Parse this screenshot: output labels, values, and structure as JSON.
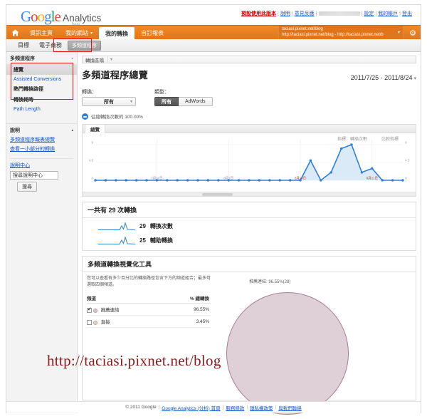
{
  "brand": {
    "google": "Google",
    "letters": [
      "G",
      "o",
      "o",
      "g",
      "l",
      "e"
    ],
    "product": "Analytics",
    "beta": "beta"
  },
  "toplinks": {
    "default_version": "預設使用此版本",
    "help": "說明",
    "feedback": "意見反應",
    "settings": "設定",
    "my_account": "我的帳戶",
    "signout": "登出"
  },
  "nav": {
    "home_icon": "home-icon",
    "tabs": [
      {
        "label": "資訊主頁",
        "active": false,
        "caret": false
      },
      {
        "label": "我的網站",
        "active": false,
        "caret": true
      },
      {
        "label": "我的轉換",
        "active": true,
        "caret": false
      },
      {
        "label": "自訂報表",
        "active": false,
        "caret": false
      }
    ],
    "account": {
      "name": "taciasi.pixnet.net/blog",
      "profile": "http://taciasi.pixnet.net/blog - http://taciasi.pixnet.net/b"
    }
  },
  "subnav": {
    "items": [
      {
        "label": "目標",
        "selected": false
      },
      {
        "label": "電子商務",
        "selected": false
      },
      {
        "label": "多頻道程序",
        "selected": true
      }
    ]
  },
  "sidebar": {
    "section_title": "多頻道程序",
    "items": [
      {
        "label": "總覽",
        "active": true
      },
      {
        "label": "Assisted Conversions",
        "active": false
      },
      {
        "label": "熱門轉換路徑",
        "active": false
      },
      {
        "label": "轉換耗時",
        "active": false
      },
      {
        "label": "Path Length",
        "active": false
      }
    ],
    "help": {
      "title": "說明",
      "links": [
        "多頻道程序報表總覽",
        "查看一小部分的轉換"
      ],
      "help_center": "說明中心",
      "search_value": "搜尋說明中心",
      "search_button": "搜尋"
    }
  },
  "main": {
    "segment_bar": "轉換區隔",
    "page_title": "多頻道程序總覽",
    "date_range": "2011/7/25 - 2011/8/24",
    "filters": {
      "conversion_label": "轉換：",
      "conversion_value": "所有",
      "type_label": "類型：",
      "type_options": [
        {
          "label": "所有",
          "active": true
        },
        {
          "label": "AdWords",
          "active": false
        }
      ]
    },
    "pct_note": "佔總轉換次數的 100.00%",
    "panel_tab": "總覽",
    "metric_label": "指標：轉換次數",
    "compare_label": "比較指標",
    "total": {
      "heading": "一共有 29 次轉換",
      "rows": [
        {
          "value": "29",
          "label": "轉換次數"
        },
        {
          "value": "25",
          "label": "輔助轉換"
        }
      ]
    },
    "viz": {
      "heading": "多頻道轉換視覺化工具",
      "description": "您可以查看有多少百分比的轉換路徑包含下方的頻道組合；最多可選取四個頻道。",
      "columns": [
        "頻道",
        "% 總轉換"
      ],
      "rows": [
        {
          "checked": true,
          "channel": "推薦連結",
          "pct": "96.55%",
          "color": "#d8c2cc"
        },
        {
          "checked": false,
          "channel": "直接",
          "pct": "3.45%",
          "color": "#e6d4b8"
        }
      ],
      "venn_label": "推薦連結: 96.55%(28)",
      "venn_fill": "#ded0d6",
      "venn_stroke": "#a97e93"
    }
  },
  "watermark": "http://taciasi.pixnet.net/blog",
  "footer": {
    "copyright": "© 2011 Google",
    "links": [
      "Google Analytics (分析) 首頁",
      "服務條款",
      "隱私權政策",
      "與我們聯絡"
    ]
  },
  "chart_data": {
    "type": "line",
    "title": "轉換次數",
    "xlabel": "",
    "ylabel": "轉換次數",
    "ylim": [
      0,
      9
    ],
    "yticks": [
      "0",
      "4.5",
      "9"
    ],
    "xticks": [
      "7月31日",
      "8月7日",
      "8月14日",
      "8月21日"
    ],
    "grid": true,
    "legend_position": "top-right",
    "series": [
      {
        "name": "轉換次數",
        "color": "#2f7ed8",
        "fill": "#dbeaf7",
        "values": [
          0,
          0,
          0,
          0,
          0,
          0,
          0,
          0,
          0,
          0,
          0,
          0,
          0,
          0,
          0,
          0,
          0,
          0,
          0,
          0,
          0,
          5,
          0,
          2,
          8,
          9,
          2,
          3,
          0,
          0,
          0
        ]
      }
    ],
    "sparklines": [
      {
        "name": "轉換次數",
        "value": 29,
        "values": [
          0,
          0,
          0,
          0,
          0,
          1,
          0,
          0,
          0,
          3,
          1,
          0,
          0
        ]
      },
      {
        "name": "輔助轉換",
        "value": 25,
        "values": [
          0,
          0,
          0,
          0,
          0,
          1,
          0,
          0,
          0,
          3,
          1,
          0,
          0
        ]
      }
    ]
  }
}
